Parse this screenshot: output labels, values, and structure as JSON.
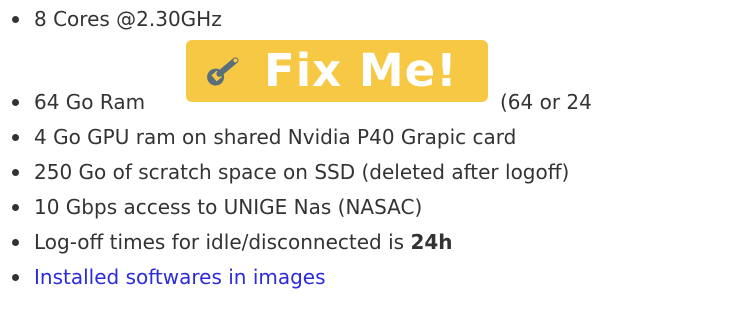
{
  "specs": {
    "cores": "8 Cores @2.30GHz",
    "ram_label": "64 Go Ram",
    "ram_note": "(64 or 24",
    "gpu": "4 Go GPU ram on shared Nvidia P40 Grapic card",
    "scratch": "250 Go of scratch space on SSD (deleted after logoff)",
    "network": "10 Gbps access to UNIGE Nas (NASAC)",
    "logoff_text": "Log-off times for idle/disconnected is ",
    "logoff_value": "24h",
    "software_link": "Installed softwares in images"
  },
  "fixme": {
    "icon": "wrench-icon",
    "label": "Fix Me!",
    "color": "#f7c844"
  },
  "colors": {
    "text": "#333333",
    "link": "#2b2bd9"
  }
}
